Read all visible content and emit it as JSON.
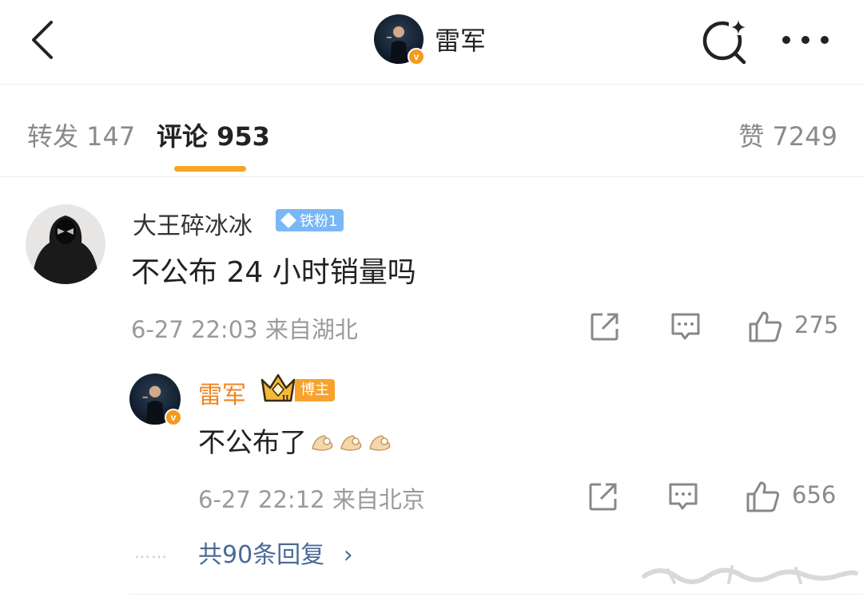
{
  "header": {
    "name": "雷军",
    "verified_mark": "v",
    "icons": [
      "back-chevron-icon",
      "search-sparkle-icon",
      "more-dots-icon"
    ]
  },
  "tabs": {
    "forward": "转发 147",
    "comments": "评论 953",
    "likes": "赞 7249",
    "active": "comments",
    "accent_color": "#f5a623"
  },
  "comment": {
    "username": "大王碎冰冰",
    "fan_badge": "铁粉1",
    "text": "不公布 24 小时销量吗",
    "meta": "6-27 22:03 来自湖北",
    "like_count": "275"
  },
  "reply": {
    "username": "雷军",
    "verified_mark": "v",
    "role_badge": "博主",
    "crown_level": "II",
    "text": "不公布了",
    "emoji": "ok-hand-emoji x3",
    "meta": "6-27 22:12 来自北京",
    "like_count": "656"
  },
  "more_replies": {
    "dots": "……",
    "label": "共90条回复",
    "chevron": "›"
  },
  "colors": {
    "name_highlight": "#f08420",
    "fan_badge": "#7ab8f5",
    "link": "#4a6a96"
  }
}
